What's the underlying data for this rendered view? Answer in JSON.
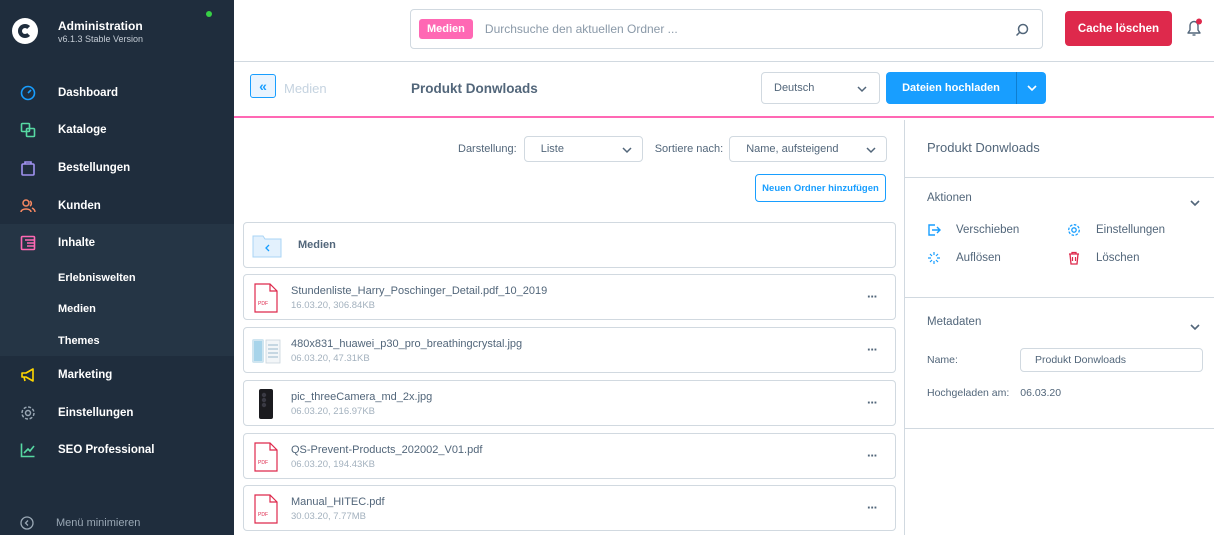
{
  "app": {
    "title": "Administration",
    "version": "v6.1.3 Stable Version"
  },
  "sidebar": {
    "items": [
      {
        "label": "Dashboard",
        "icon": "gauge-icon",
        "color": "#189eff"
      },
      {
        "label": "Kataloge",
        "icon": "catalog-icon",
        "color": "#57d9a3"
      },
      {
        "label": "Bestellungen",
        "icon": "bag-icon",
        "color": "#a092f0"
      },
      {
        "label": "Kunden",
        "icon": "users-icon",
        "color": "#f88962"
      },
      {
        "label": "Inhalte",
        "icon": "content-icon",
        "color": "#ff68b4"
      }
    ],
    "subitems": [
      {
        "label": "Erlebniswelten"
      },
      {
        "label": "Medien"
      },
      {
        "label": "Themes"
      }
    ],
    "items_bottom": [
      {
        "label": "Marketing",
        "icon": "megaphone-icon",
        "color": "#ffd700"
      },
      {
        "label": "Einstellungen",
        "icon": "gear-icon",
        "color": "#9aa8b5"
      },
      {
        "label": "SEO Professional",
        "icon": "chart-icon",
        "color": "#57d9a3"
      }
    ],
    "footer": "Menü minimieren"
  },
  "topbar": {
    "search_tag": "Medien",
    "search_placeholder": "Durchsuche den aktuellen Ordner ...",
    "cache_button": "Cache löschen"
  },
  "smartbar": {
    "back_label": "«",
    "breadcrumb": "Medien",
    "title": "Produkt Donwloads",
    "language": "Deutsch",
    "upload_button": "Dateien hochladen"
  },
  "toolbar": {
    "view_label": "Darstellung:",
    "view_value": "Liste",
    "sort_label": "Sortiere nach:",
    "sort_value": "Name, aufsteigend",
    "new_folder_button": "Neuen Ordner hinzufügen"
  },
  "folder": {
    "name": "Medien"
  },
  "files": [
    {
      "name": "Stundenliste_Harry_Poschinger_Detail.pdf_10_2019",
      "meta": "16.03.20, 306.84KB",
      "type": "pdf"
    },
    {
      "name": "480x831_huawei_p30_pro_breathingcrystal.jpg",
      "meta": "06.03.20, 47.31KB",
      "type": "phone-image"
    },
    {
      "name": "pic_threeCamera_md_2x.jpg",
      "meta": "06.03.20, 216.97KB",
      "type": "camera-image"
    },
    {
      "name": "QS-Prevent-Products_202002_V01.pdf",
      "meta": "06.03.20, 194.43KB",
      "type": "pdf"
    },
    {
      "name": "Manual_HITEC.pdf",
      "meta": "30.03.20, 7.77MB",
      "type": "pdf"
    }
  ],
  "panel": {
    "title": "Produkt Donwloads",
    "actions_title": "Aktionen",
    "actions": {
      "move": "Verschieben",
      "settings": "Einstellungen",
      "dissolve": "Auflösen",
      "delete": "Löschen"
    },
    "metadata_title": "Metadaten",
    "name_label": "Name:",
    "name_value": "Produkt Donwloads",
    "uploaded_label": "Hochgeladen am:",
    "uploaded_value": "06.03.20"
  },
  "colors": {
    "accent": "#189eff",
    "danger": "#de294c",
    "content_pink": "#ff68b4",
    "sidebar_bg": "#1f2d3d"
  }
}
